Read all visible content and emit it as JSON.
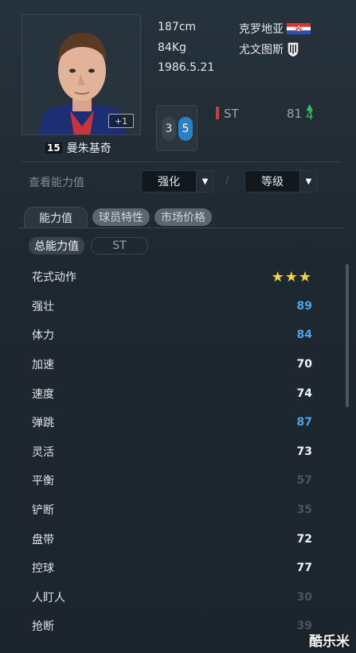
{
  "player": {
    "name": "曼朱基奇",
    "card_level": "+1",
    "height": "187cm",
    "weight": "84Kg",
    "birthdate": "1986.5.21",
    "nation": "克罗地亚",
    "club": "尤文图斯",
    "left_foot": "3",
    "right_foot": "5",
    "position": "ST",
    "overall": "81",
    "overall_bonus": "4"
  },
  "controls": {
    "view_label": "查看能力值",
    "enhance_select": "强化",
    "grade_select": "等级",
    "separator": "/"
  },
  "tabs": [
    "能力值",
    "球员特性",
    "市场价格"
  ],
  "subtabs": [
    "总能力值",
    "ST"
  ],
  "stats": [
    {
      "label": "花式动作",
      "value": "★★★",
      "kind": "stars"
    },
    {
      "label": "强壮",
      "value": "89",
      "kind": "blue"
    },
    {
      "label": "体力",
      "value": "84",
      "kind": "blue"
    },
    {
      "label": "加速",
      "value": "70",
      "kind": "white"
    },
    {
      "label": "速度",
      "value": "74",
      "kind": "white"
    },
    {
      "label": "弹跳",
      "value": "87",
      "kind": "blue"
    },
    {
      "label": "灵活",
      "value": "73",
      "kind": "white"
    },
    {
      "label": "平衡",
      "value": "57",
      "kind": "dim"
    },
    {
      "label": "铲断",
      "value": "35",
      "kind": "dim"
    },
    {
      "label": "盘带",
      "value": "72",
      "kind": "white"
    },
    {
      "label": "控球",
      "value": "77",
      "kind": "white"
    },
    {
      "label": "人盯人",
      "value": "30",
      "kind": "dim"
    },
    {
      "label": "抢断",
      "value": "39",
      "kind": "dim"
    }
  ],
  "watermark": "酷乐米",
  "colors": {
    "accent_blue": "#4aa3e8",
    "bonus_green": "#35c25a",
    "position_red": "#d23a3a",
    "star_gold": "#f3d23a"
  }
}
